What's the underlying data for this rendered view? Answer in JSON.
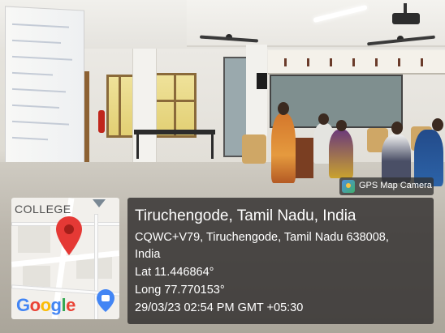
{
  "map": {
    "place_label": "COLLEGE",
    "google": {
      "letters": [
        "G",
        "o",
        "o",
        "g",
        "l",
        "e"
      ],
      "letter_colors": [
        "#4285f4",
        "#ea4335",
        "#fbbc05",
        "#4285f4",
        "#34a853",
        "#ea4335"
      ]
    },
    "pin_color": "#e53935",
    "place_pin_color": "#4285f4"
  },
  "location": {
    "title": "Tiruchengode, Tamil Nadu, India",
    "address_line1": "CQWC+V79, Tiruchengode, Tamil Nadu 638008,",
    "address_line2": "India",
    "latitude": "Lat 11.446864°",
    "longitude": "Long 77.770153°",
    "datetime": "29/03/23 02:54 PM GMT +05:30"
  },
  "badge": {
    "label": "GPS Map Camera",
    "icon": "gps-map-camera-icon"
  }
}
